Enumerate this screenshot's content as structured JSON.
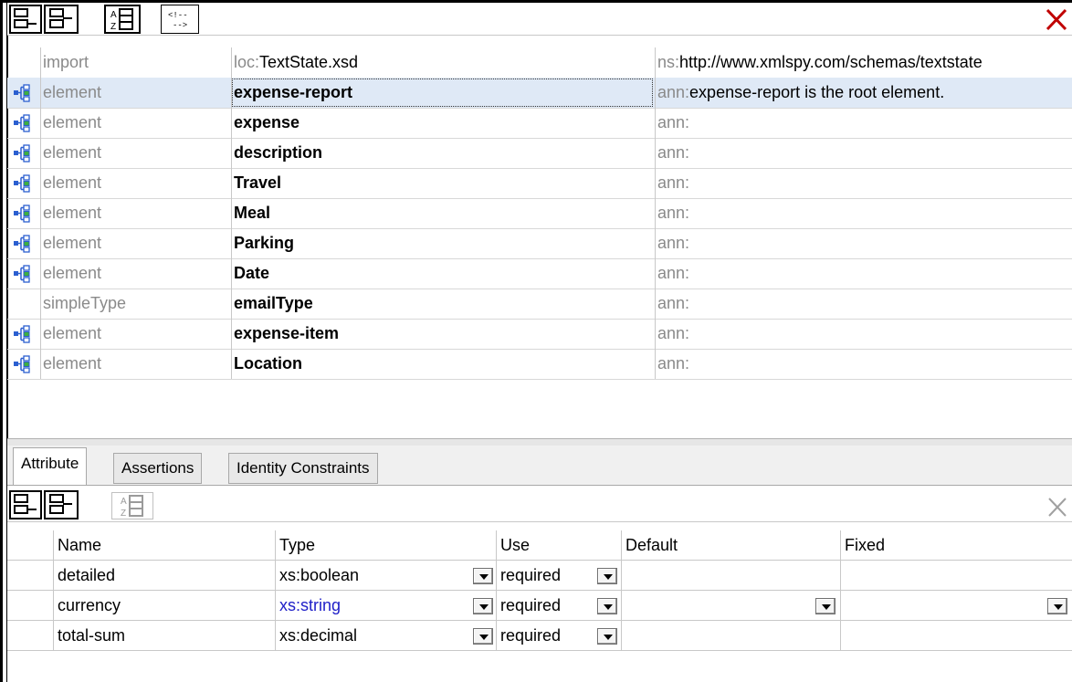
{
  "top_table": {
    "rows": [
      {
        "kind": "import",
        "name_prefix": "loc:",
        "name": "TextState.xsd",
        "ann_prefix": "ns:",
        "ann": "http://www.xmlspy.com/schemas/textstate",
        "icon": "none",
        "bold": false
      },
      {
        "kind": "element",
        "name": "expense-report",
        "ann_prefix": "ann:",
        "ann": "expense-report is the root element.",
        "icon": "element-tree-icon",
        "selected": true
      },
      {
        "kind": "element",
        "name": "expense",
        "ann_prefix": "ann:",
        "ann": "",
        "icon": "element-tree-icon"
      },
      {
        "kind": "element",
        "name": "description",
        "ann_prefix": "ann:",
        "ann": "",
        "icon": "element-tree-icon"
      },
      {
        "kind": "element",
        "name": "Travel",
        "ann_prefix": "ann:",
        "ann": "",
        "icon": "element-tree-icon"
      },
      {
        "kind": "element",
        "name": "Meal",
        "ann_prefix": "ann:",
        "ann": "",
        "icon": "element-tree-icon"
      },
      {
        "kind": "element",
        "name": "Parking",
        "ann_prefix": "ann:",
        "ann": "",
        "icon": "element-tree-icon"
      },
      {
        "kind": "element",
        "name": "Date",
        "ann_prefix": "ann:",
        "ann": "",
        "icon": "element-tree-icon"
      },
      {
        "kind": "simpleType",
        "name": "emailType",
        "ann_prefix": "ann:",
        "ann": "",
        "icon": "none"
      },
      {
        "kind": "element",
        "name": "expense-item",
        "ann_prefix": "ann:",
        "ann": "",
        "icon": "element-tree-icon"
      },
      {
        "kind": "element",
        "name": "Location",
        "ann_prefix": "ann:",
        "ann": "",
        "icon": "element-tree-icon"
      }
    ]
  },
  "tabs": [
    {
      "label": "Attribute",
      "active": true
    },
    {
      "label": "Assertions",
      "active": false
    },
    {
      "label": "Identity Constraints",
      "active": false
    }
  ],
  "attr_grid": {
    "headers": [
      "Name",
      "Type",
      "Use",
      "Default",
      "Fixed"
    ],
    "rows": [
      {
        "name": "detailed",
        "type": "xs:boolean",
        "use": "required",
        "default": "",
        "fixed": "",
        "type_color": "#000000"
      },
      {
        "name": "currency",
        "type": "xs:string",
        "use": "required",
        "default": "",
        "fixed": "",
        "type_color": "#2020c8"
      },
      {
        "name": "total-sum",
        "type": "xs:decimal",
        "use": "required",
        "default": "",
        "fixed": "",
        "type_color": "#000000"
      }
    ]
  },
  "colors": {
    "selected_row": "#dfe9f6",
    "close_red": "#c00000",
    "muted_text": "#8a8a8a"
  }
}
